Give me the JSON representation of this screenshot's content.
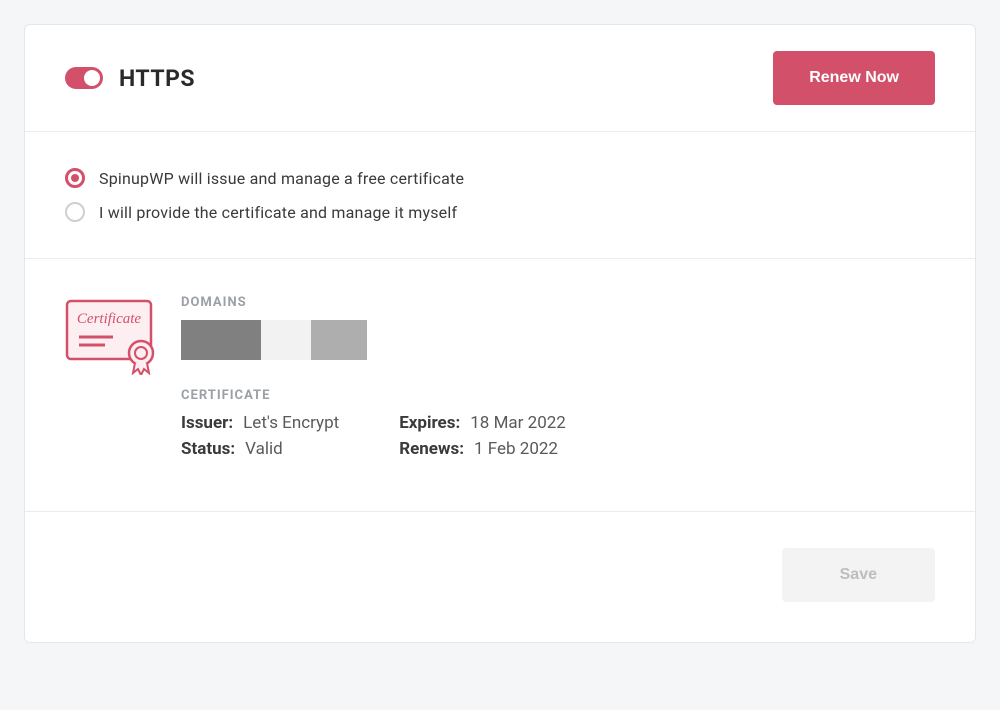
{
  "header": {
    "title": "HTTPS",
    "renew_label": "Renew Now",
    "toggle_on": true
  },
  "radios": {
    "option1": "SpinupWP will issue and manage a free certificate",
    "option2": "I will provide the certificate and manage it myself"
  },
  "domains": {
    "label": "DOMAINS"
  },
  "certificate": {
    "label": "CERTIFICATE",
    "issuer_key": "Issuer:",
    "issuer_val": "Let's Encrypt",
    "status_key": "Status:",
    "status_val": "Valid",
    "expires_key": "Expires:",
    "expires_val": "18 Mar 2022",
    "renews_key": "Renews:",
    "renews_val": "1 Feb 2022"
  },
  "footer": {
    "save_label": "Save"
  },
  "icon": {
    "certificate_text": "Certificate"
  }
}
